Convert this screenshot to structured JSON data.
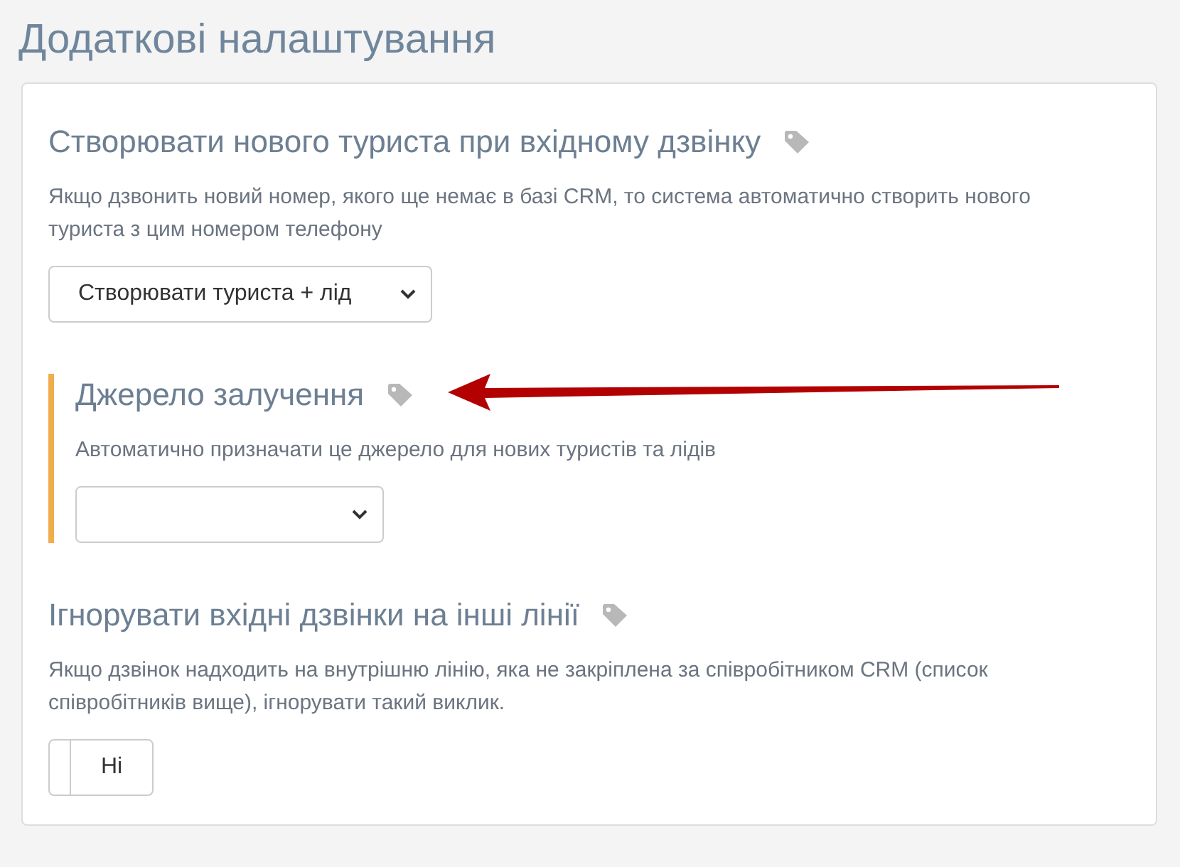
{
  "page_title": "Додаткові налаштування",
  "sections": [
    {
      "kind": "select",
      "title": "Створювати нового туриста при вхідному дзвінку",
      "description": "Якщо дзвонить новий номер, якого ще немає в базі CRM, то система автоматично створить нового туриста з цим номером телефону",
      "value": "Створювати туриста + лід"
    },
    {
      "kind": "select",
      "title": "Джерело залучення",
      "description": "Автоматично призначати це джерело для нових туристів та лідів",
      "highlighted": true,
      "arrow": true
    },
    {
      "kind": "toggle",
      "title": "Ігнорувати вхідні дзвінки на інші лінії",
      "description": "Якщо дзвінок надходить на внутрішню лінію, яка не закріплена за співробітником CRM (список співробітників вище), ігнорувати такий виклик.",
      "value": "Ні",
      "on": false
    }
  ]
}
